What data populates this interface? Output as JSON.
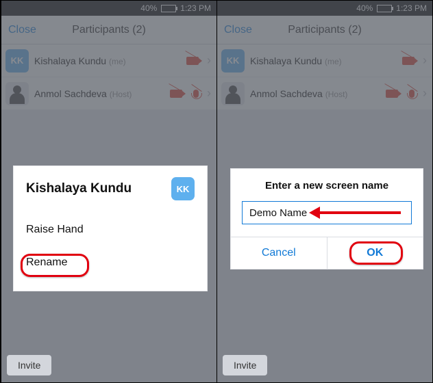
{
  "status": {
    "battery": "40%",
    "time": "1:23 PM"
  },
  "header": {
    "close": "Close",
    "title": "Participants (2)"
  },
  "participants": [
    {
      "avatar_initials": "KK",
      "name": "Kishalaya Kundu",
      "tag": "(me)"
    },
    {
      "name": "Anmol Sachdeva",
      "tag": "(Host)"
    }
  ],
  "invite_label": "Invite",
  "sheet": {
    "title": "Kishalaya Kundu",
    "avatar_initials": "KK",
    "raise_hand": "Raise Hand",
    "rename": "Rename"
  },
  "dialog": {
    "title": "Enter a new screen name",
    "input_value": "Demo Name",
    "cancel": "Cancel",
    "ok": "OK"
  }
}
